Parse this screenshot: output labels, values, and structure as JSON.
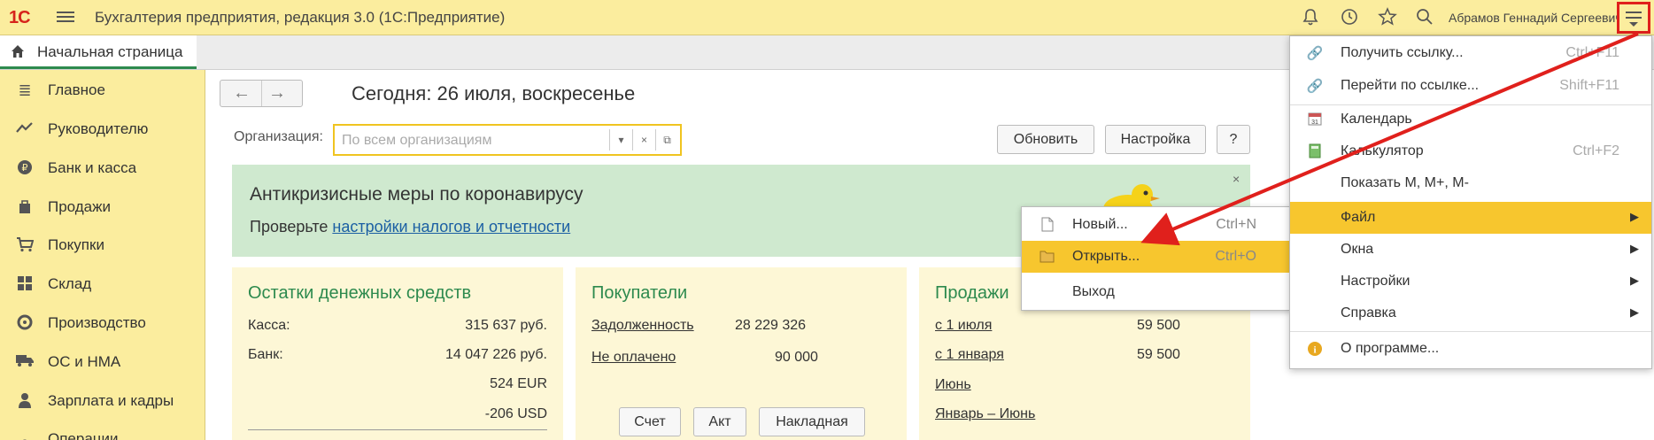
{
  "app": {
    "logo_text": "1С",
    "title": "Бухгалтерия предприятия, редакция 3.0  (1С:Предприятие)",
    "user": "Абрамов Геннадий Сергеевич"
  },
  "tabs": {
    "home": "Начальная страница"
  },
  "sidebar": {
    "items": [
      {
        "label": "Главное",
        "icon": "list-icon"
      },
      {
        "label": "Руководителю",
        "icon": "trend-icon"
      },
      {
        "label": "Банк и касса",
        "icon": "coin-icon"
      },
      {
        "label": "Продажи",
        "icon": "bag-icon"
      },
      {
        "label": "Покупки",
        "icon": "cart-icon"
      },
      {
        "label": "Склад",
        "icon": "grid-icon"
      },
      {
        "label": "Производство",
        "icon": "factory-icon"
      },
      {
        "label": "ОС и НМА",
        "icon": "truck-icon"
      },
      {
        "label": "Зарплата и кадры",
        "icon": "person-icon"
      },
      {
        "label": "Операции",
        "icon": "ops-icon"
      }
    ]
  },
  "main": {
    "today": "Сегодня: 26 июля, воскресенье",
    "org_label": "Организация:",
    "org_placeholder": "По всем организациям",
    "refresh": "Обновить",
    "settings": "Настройка",
    "help": "?",
    "banner": {
      "title": "Антикризисные меры по коронавирусу",
      "text": "Проверьте ",
      "link": "настройки налогов и отчетности",
      "close": "×"
    },
    "cash": {
      "title": "Остатки денежных средств",
      "rows": [
        {
          "label": "Касса:",
          "value": "315 637 руб."
        },
        {
          "label": "Банк:",
          "value": "14 047 226 руб."
        },
        {
          "label": "",
          "value": "524 EUR"
        },
        {
          "label": "",
          "value": "-206 USD"
        }
      ]
    },
    "customers": {
      "title": "Покупатели",
      "rows": [
        {
          "label": "Задолженность",
          "value": "28 229 326"
        },
        {
          "label": "Не оплачено",
          "value": "90 000"
        }
      ],
      "buttons": [
        "Счет",
        "Акт",
        "Накладная"
      ]
    },
    "sales": {
      "title": "Продажи",
      "rows": [
        {
          "label": "с 1 июля",
          "value": "59 500"
        },
        {
          "label": "с 1 января",
          "value": "59 500"
        },
        {
          "label": "Июнь",
          "value": ""
        },
        {
          "label": "Январь – Июнь",
          "value": ""
        }
      ]
    }
  },
  "file_submenu": {
    "items": [
      {
        "label": "Новый...",
        "shortcut": "Ctrl+N",
        "icon": "new-file-icon"
      },
      {
        "label": "Открыть...",
        "shortcut": "Ctrl+O",
        "icon": "open-folder-icon",
        "active": true
      },
      {
        "label": "Выход",
        "shortcut": "",
        "icon": ""
      }
    ]
  },
  "main_menu": {
    "items": [
      {
        "label": "Получить ссылку...",
        "shortcut": "Ctrl+F11",
        "icon": "link-icon"
      },
      {
        "label": "Перейти по ссылке...",
        "shortcut": "Shift+F11",
        "icon": "goto-link-icon"
      },
      {
        "label": "Календарь",
        "shortcut": "",
        "icon": "calendar-icon"
      },
      {
        "label": "Калькулятор",
        "shortcut": "Ctrl+F2",
        "icon": "calculator-icon"
      },
      {
        "label": "Показать М, М+, М-",
        "shortcut": "",
        "icon": ""
      },
      {
        "label": "Файл",
        "shortcut": "",
        "icon": "",
        "submenu": true,
        "active": true
      },
      {
        "label": "Окна",
        "shortcut": "",
        "icon": "",
        "submenu": true
      },
      {
        "label": "Настройки",
        "shortcut": "",
        "icon": "",
        "submenu": true
      },
      {
        "label": "Справка",
        "shortcut": "",
        "icon": "",
        "submenu": true
      },
      {
        "label": "О программе...",
        "shortcut": "",
        "icon": "info-icon"
      }
    ]
  },
  "colors": {
    "panel": "#fbed9e",
    "accent_active": "#f7c62e",
    "green_title": "#2d8a4e",
    "link": "#1b5fa3",
    "annotation": "#e0201c"
  }
}
